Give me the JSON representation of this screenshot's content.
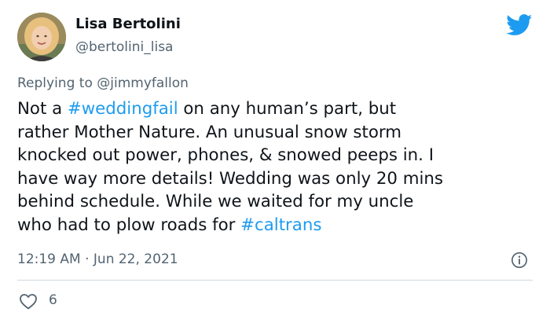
{
  "author": {
    "display_name": "Lisa Bertolini",
    "handle": "@bertolini_lisa"
  },
  "reply": {
    "prefix": "Replying to ",
    "mention": "@jimmyfallon"
  },
  "tweet": {
    "line1_pre": "Not a ",
    "line1_hashtag": "#weddingfail",
    "line1_post": " on any human’s part, but",
    "line2": "rather Mother Nature. An unusual snow storm",
    "line3": "knocked out power, phones, & snowed peeps in. I",
    "line4": "have way more details! Wedding was only 20 mins",
    "line5": "behind schedule. While we waited for my uncle",
    "line6_pre": "who had to plow roads for ",
    "line6_hashtag": "#caltrans"
  },
  "meta": {
    "timestamp": "12:19 AM · Jun 22, 2021"
  },
  "engagement": {
    "likes": "6"
  },
  "icons": {
    "brand": "twitter-bird-icon",
    "info": "info-icon",
    "like": "heart-icon"
  },
  "colors": {
    "link": "#1d9bf0",
    "secondary_text": "#536471",
    "primary_text": "#0f1419",
    "divider": "#cfd9de"
  }
}
